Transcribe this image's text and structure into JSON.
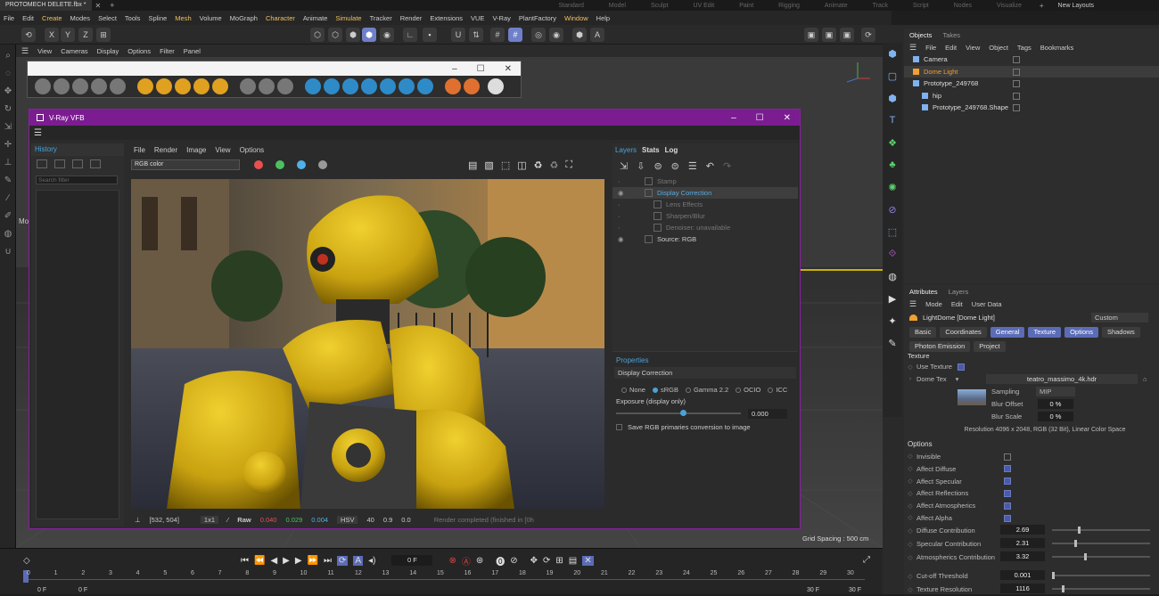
{
  "top_bar": {
    "file_tab": "PROTOMECH DELETE.fbx *",
    "layouts": [
      "Standard",
      "Model",
      "Sculpt",
      "UV Edit",
      "Paint",
      "Rigging",
      "Animate",
      "Track",
      "Script",
      "Nodes",
      "Visualize"
    ],
    "new_layouts": "New Layouts"
  },
  "menu": [
    "File",
    "Edit",
    "Create",
    "Modes",
    "Select",
    "Tools",
    "Spline",
    "Mesh",
    "Volume",
    "MoGraph",
    "Character",
    "Animate",
    "Simulate",
    "Tracker",
    "Render",
    "Extensions",
    "VUE",
    "V-Ray",
    "PlantFactory",
    "Window",
    "Help"
  ],
  "toolbar": {
    "x": "X",
    "y": "Y",
    "z": "Z"
  },
  "viewport": {
    "menu": [
      "View",
      "Cameras",
      "Display",
      "Options",
      "Filter",
      "Panel"
    ],
    "grid_spacing": "Grid Spacing : 500 cm",
    "left_label": "Mo"
  },
  "vfb": {
    "title": "V-Ray VFB",
    "history_tab": "History",
    "search_placeholder": "Search filter",
    "menu": [
      "File",
      "Render",
      "Image",
      "View",
      "Options"
    ],
    "channel": "RGB color",
    "status": {
      "coords": "[532, 504]",
      "zoom": "1x1",
      "raw": "Raw",
      "r": "0.040",
      "g": "0.029",
      "b": "0.004",
      "mode": "HSV",
      "h": "40",
      "s": "0.9",
      "v": "0.0",
      "message": "Render completed (finished in [0h"
    },
    "right_tabs": [
      "Layers",
      "Stats",
      "Log"
    ],
    "layers": [
      {
        "name": "Stamp",
        "state": "dim"
      },
      {
        "name": "Display Correction",
        "state": "selected"
      },
      {
        "name": "Lens Effects",
        "state": "dim"
      },
      {
        "name": "Sharpen/Blur",
        "state": "dim"
      },
      {
        "name": "Denoiser: unavailable",
        "state": "dim"
      },
      {
        "name": "Source: RGB",
        "state": "on"
      }
    ],
    "properties": {
      "title": "Properties",
      "section": "Display Correction",
      "options": [
        "None",
        "sRGB",
        "Gamma 2.2",
        "OCIO",
        "ICC"
      ],
      "selected_option": "sRGB",
      "exposure_label": "Exposure (display only)",
      "exposure_value": "0.000",
      "save_label": "Save RGB primaries conversion to image"
    }
  },
  "objects": {
    "tabs": [
      "Objects",
      "Takes"
    ],
    "menu": [
      "File",
      "Edit",
      "View",
      "Object",
      "Tags",
      "Bookmarks"
    ],
    "items": [
      {
        "name": "Camera",
        "indent": 0,
        "color": "#dddddd"
      },
      {
        "name": "Dome Light",
        "indent": 0,
        "color": "#f0a030"
      },
      {
        "name": "Prototype_249768",
        "indent": 0,
        "color": "#dddddd"
      },
      {
        "name": "hip",
        "indent": 1,
        "color": "#dddddd"
      },
      {
        "name": "Prototype_249768.Shape",
        "indent": 1,
        "color": "#dddddd"
      }
    ]
  },
  "attributes": {
    "tabs": [
      "Attributes",
      "Layers"
    ],
    "menu": [
      "Mode",
      "Edit",
      "User Data"
    ],
    "object_name": "LightDome [Dome Light]",
    "preset": "Custom",
    "buttons_row1": [
      "Basic",
      "Coordinates",
      "General",
      "Texture",
      "Options",
      "Shadows"
    ],
    "active_buttons": [
      "General",
      "Texture",
      "Options"
    ],
    "buttons_row2": [
      "Photon Emission",
      "Project"
    ],
    "section_texture": "Texture",
    "use_texture": "Use Texture",
    "dome_tex_label": "Dome Tex",
    "dome_tex_file": "teatro_massimo_4k.hdr",
    "sampling_label": "Sampling",
    "sampling_value": "MIP",
    "blur_offset_label": "Blur Offset",
    "blur_offset_value": "0 %",
    "blur_scale_label": "Blur Scale",
    "blur_scale_value": "0 %",
    "resolution": "Resolution 4096 x 2048, RGB (32 Bit), Linear Color Space",
    "section_options": "Options",
    "checks": [
      {
        "label": "Invisible",
        "checked": false
      },
      {
        "label": "Affect Diffuse",
        "checked": true
      },
      {
        "label": "Affect Specular",
        "checked": true
      },
      {
        "label": "Affect Reflections",
        "checked": true
      },
      {
        "label": "Affect Atmospherics",
        "checked": true
      },
      {
        "label": "Affect Alpha",
        "checked": true
      }
    ],
    "numbers": [
      {
        "label": "Diffuse Contribution",
        "value": "2.69",
        "level": 0.27
      },
      {
        "label": "Specular Contribution",
        "value": "2.31",
        "level": 0.23
      },
      {
        "label": "Atmospherics Contribution",
        "value": "3.32",
        "level": 0.33
      },
      {
        "label": "Cut-off Threshold",
        "value": "0.001",
        "level": 0.0
      },
      {
        "label": "Texture Resolution",
        "value": "1116",
        "level": 0.1
      }
    ]
  },
  "timeline": {
    "frame": "0 F",
    "ticks": [
      "0",
      "1",
      "2",
      "3",
      "4",
      "5",
      "6",
      "7",
      "8",
      "9",
      "10",
      "11",
      "12",
      "13",
      "14",
      "15",
      "16",
      "17",
      "18",
      "19",
      "20",
      "21",
      "22",
      "23",
      "24",
      "25",
      "26",
      "27",
      "28",
      "29",
      "30"
    ],
    "start": "0 F",
    "start2": "0 F",
    "end": "30 F",
    "end2": "30 F"
  }
}
